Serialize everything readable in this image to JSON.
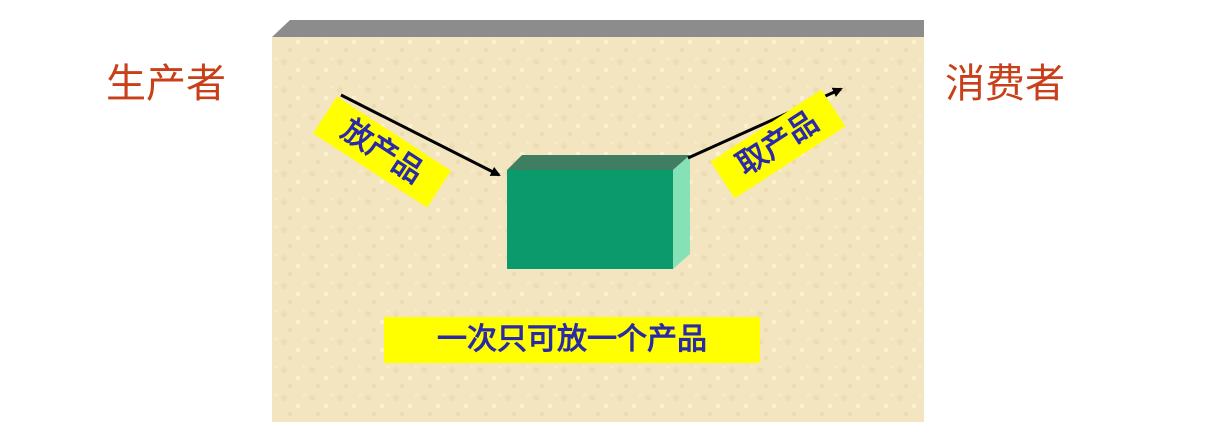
{
  "producer_label": "生产者",
  "consumer_label": "消费者",
  "put_label": "放产品",
  "take_label": "取产品",
  "note_text": "一次只可放一个产品",
  "colors": {
    "side_label_text": "#c8401a",
    "tag_text": "#2a2aa8",
    "tag_background": "#ffff00",
    "panel_background": "#f3e5c0",
    "panel_top_bar": "#8c8c8c",
    "box_front": "#0a9a6c",
    "box_top": "#3f7e62",
    "box_side": "#86e2b6",
    "arrow": "#000000"
  }
}
